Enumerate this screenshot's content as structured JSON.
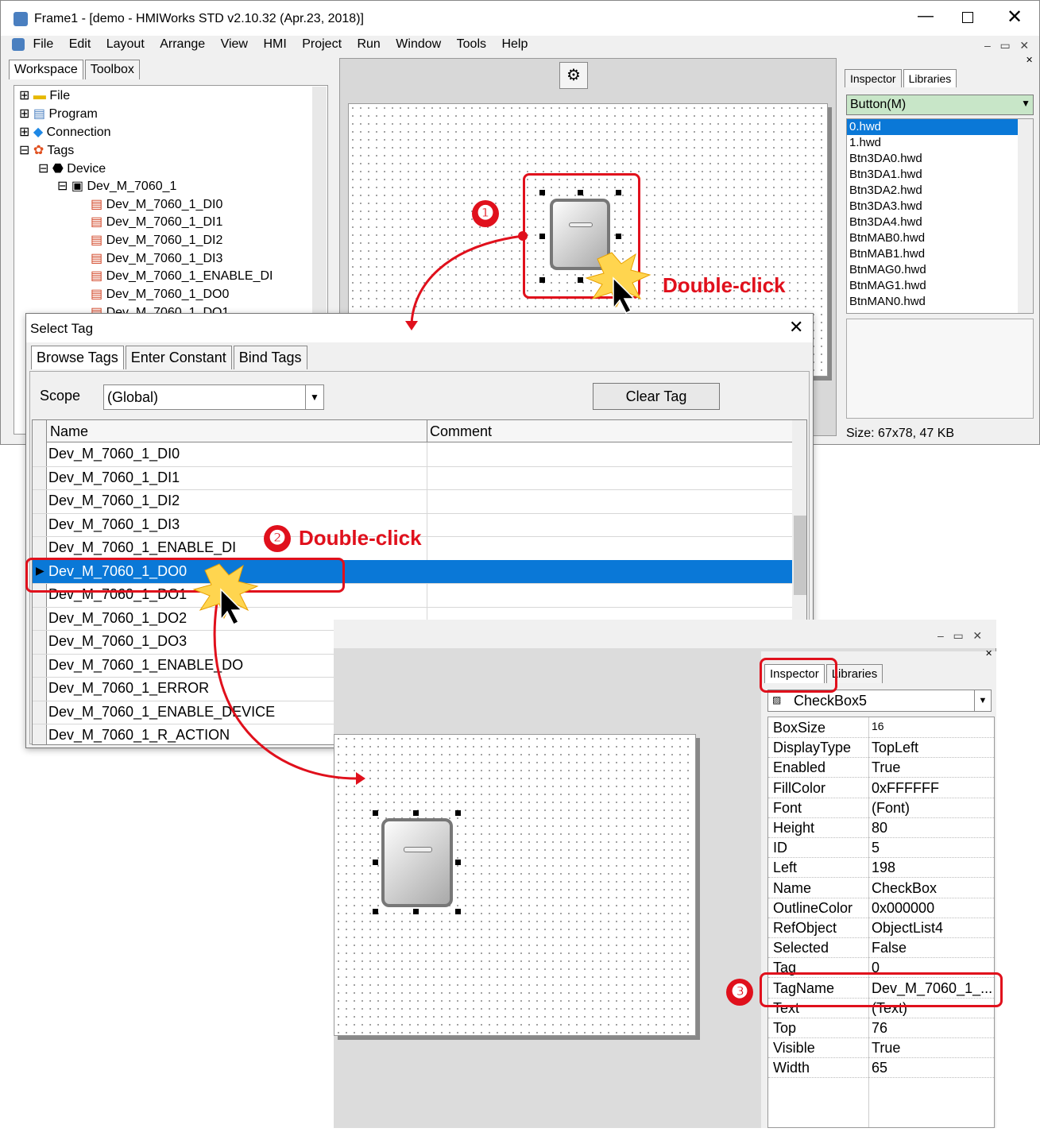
{
  "window": {
    "title": "Frame1 - [demo - HMIWorks STD v2.10.32 (Apr.23, 2018)]"
  },
  "menu": [
    "File",
    "Edit",
    "Layout",
    "Arrange",
    "View",
    "HMI",
    "Project",
    "Run",
    "Window",
    "Tools",
    "Help"
  ],
  "workspace": {
    "tabs": [
      "Workspace",
      "Toolbox"
    ],
    "tree": [
      {
        "label": "File"
      },
      {
        "label": "Program"
      },
      {
        "label": "Connection"
      },
      {
        "label": "Tags"
      },
      {
        "label": "Device"
      },
      {
        "label": "Dev_M_7060_1"
      },
      {
        "label": "Dev_M_7060_1_DI0"
      },
      {
        "label": "Dev_M_7060_1_DI1"
      },
      {
        "label": "Dev_M_7060_1_DI2"
      },
      {
        "label": "Dev_M_7060_1_DI3"
      },
      {
        "label": "Dev_M_7060_1_ENABLE_DI"
      },
      {
        "label": "Dev_M_7060_1_DO0"
      },
      {
        "label": "Dev_M_7060_1_DO1"
      }
    ]
  },
  "libraries": {
    "tabs": [
      "Inspector",
      "Libraries"
    ],
    "category": "Button(M)",
    "files": [
      "0.hwd",
      "1.hwd",
      "Btn3DA0.hwd",
      "Btn3DA1.hwd",
      "Btn3DA2.hwd",
      "Btn3DA3.hwd",
      "Btn3DA4.hwd",
      "BtnMAB0.hwd",
      "BtnMAB1.hwd",
      "BtnMAG0.hwd",
      "BtnMAG1.hwd",
      "BtnMAN0.hwd"
    ],
    "size": "Size: 67x78, 47 KB"
  },
  "dialog": {
    "title": "Select Tag",
    "tabs": [
      "Browse Tags",
      "Enter Constant",
      "Bind Tags"
    ],
    "scope_label": "Scope",
    "scope_value": "(Global)",
    "clear_button": "Clear Tag",
    "columns": [
      "Name",
      "Comment"
    ],
    "rows": [
      "Dev_M_7060_1_DI0",
      "Dev_M_7060_1_DI1",
      "Dev_M_7060_1_DI2",
      "Dev_M_7060_1_DI3",
      "Dev_M_7060_1_ENABLE_DI",
      "Dev_M_7060_1_DO0",
      "Dev_M_7060_1_DO1",
      "Dev_M_7060_1_DO2",
      "Dev_M_7060_1_DO3",
      "Dev_M_7060_1_ENABLE_DO",
      "Dev_M_7060_1_ERROR",
      "Dev_M_7060_1_ENABLE_DEVICE",
      "Dev_M_7060_1_R_ACTION"
    ],
    "selected_row": "Dev_M_7060_1_DO0"
  },
  "inspector": {
    "tabs": [
      "Inspector",
      "Libraries"
    ],
    "object": "CheckBox5",
    "properties": [
      {
        "k": "BoxSize",
        "v": "16"
      },
      {
        "k": "DisplayType",
        "v": "TopLeft"
      },
      {
        "k": "Enabled",
        "v": "True"
      },
      {
        "k": "FillColor",
        "v": "0xFFFFFF"
      },
      {
        "k": "Font",
        "v": "(Font)"
      },
      {
        "k": "Height",
        "v": "80"
      },
      {
        "k": "ID",
        "v": "5"
      },
      {
        "k": "Left",
        "v": "198"
      },
      {
        "k": "Name",
        "v": "CheckBox"
      },
      {
        "k": "OutlineColor",
        "v": "0x000000"
      },
      {
        "k": "RefObject",
        "v": "ObjectList4"
      },
      {
        "k": "Selected",
        "v": "False"
      },
      {
        "k": "Tag",
        "v": "0"
      },
      {
        "k": "TagName",
        "v": "Dev_M_7060_1_..."
      },
      {
        "k": "Text",
        "v": "(Text)"
      },
      {
        "k": "Top",
        "v": "76"
      },
      {
        "k": "Visible",
        "v": "True"
      },
      {
        "k": "Width",
        "v": "65"
      }
    ]
  },
  "annotations": {
    "step1": "❶",
    "step2": "❷",
    "step3": "❸",
    "double_click_1": "Double-click",
    "double_click_2": "Double-click"
  },
  "colors": {
    "accent_red": "#e0101c",
    "selection_blue": "#0a78d7",
    "highlight_green": "#c8e6c8"
  }
}
